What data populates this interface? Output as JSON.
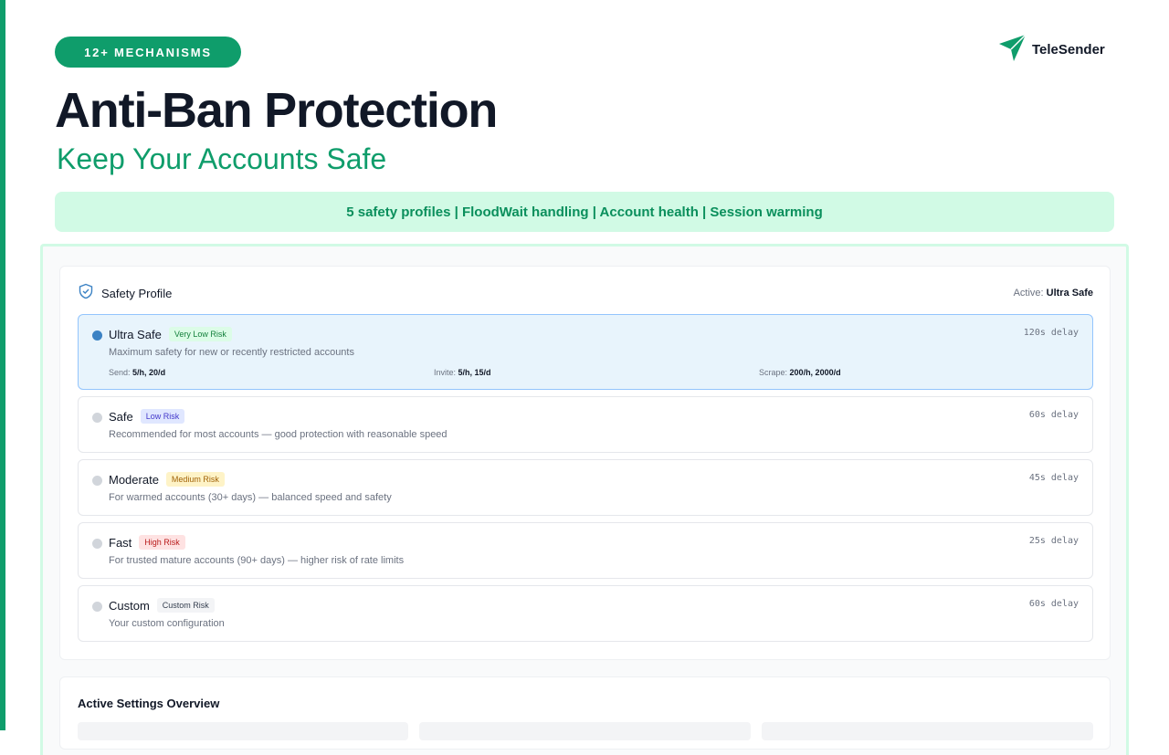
{
  "badge": "12+ MECHANISMS",
  "brand": {
    "name": "TeleSender",
    "icon": "paper-plane-icon",
    "color": "#0f9d6b"
  },
  "hero": {
    "title": "Anti-Ban Protection",
    "subtitle": "Keep Your Accounts Safe"
  },
  "features_banner": "5 safety profiles | FloodWait handling | Account health | Session warming",
  "safety_profile": {
    "title": "Safety Profile",
    "icon": "shield-check-icon",
    "active_label": "Active:",
    "active_value": "Ultra Safe",
    "profiles": [
      {
        "name": "Ultra Safe",
        "risk": "Very Low Risk",
        "description": "Maximum safety for new or recently restricted accounts",
        "delay": "120s delay",
        "selected": true,
        "limits": {
          "send_label": "Send:",
          "send_value": "5/h, 20/d",
          "invite_label": "Invite:",
          "invite_value": "5/h, 15/d",
          "scrape_label": "Scrape:",
          "scrape_value": "200/h, 2000/d"
        }
      },
      {
        "name": "Safe",
        "risk": "Low Risk",
        "description": "Recommended for most accounts — good protection with reasonable speed",
        "delay": "60s delay",
        "selected": false
      },
      {
        "name": "Moderate",
        "risk": "Medium Risk",
        "description": "For warmed accounts (30+ days) — balanced speed and safety",
        "delay": "45s delay",
        "selected": false
      },
      {
        "name": "Fast",
        "risk": "High Risk",
        "description": "For trusted mature accounts (90+ days) — higher risk of rate limits",
        "delay": "25s delay",
        "selected": false
      },
      {
        "name": "Custom",
        "risk": "Custom Risk",
        "description": "Your custom configuration",
        "delay": "60s delay",
        "selected": false
      }
    ]
  },
  "overview": {
    "title": "Active Settings Overview"
  },
  "colors": {
    "accent": "#0f9d6b",
    "banner_bg": "#d1fae5",
    "selected_bg": "#e8f4fc",
    "selected_dot": "#3b82c4"
  }
}
